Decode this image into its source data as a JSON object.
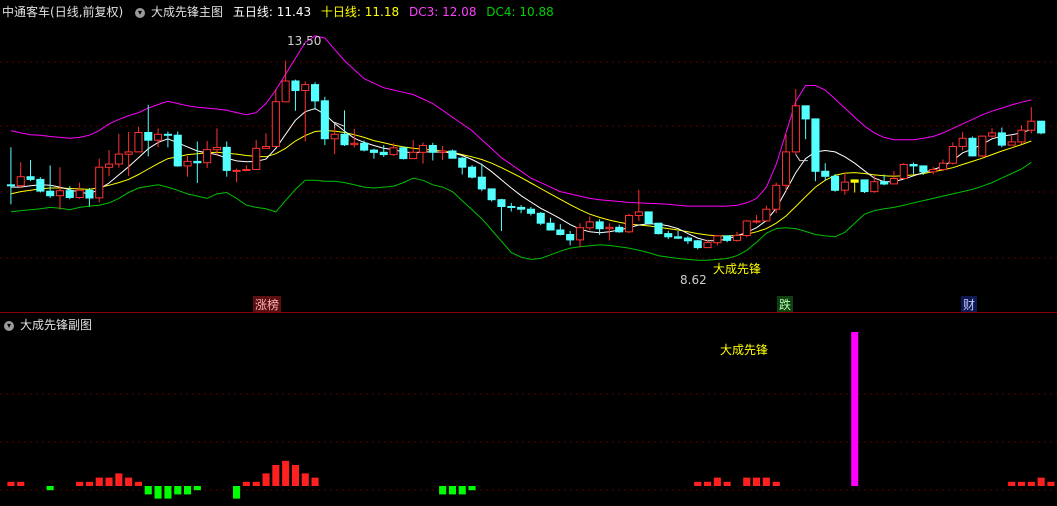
{
  "header": {
    "stock_name": "中通客车",
    "period": "(日线,前复权)",
    "indicator_name": "大成先锋主图",
    "ma5_label": "五日线: ",
    "ma5_value": "11.43",
    "ma10_label": "十日线: ",
    "ma10_value": "11.18",
    "dc3_label": "DC3: ",
    "dc3_value": "12.08",
    "dc4_label": "DC4: ",
    "dc4_value": "10.88"
  },
  "annotations": {
    "high_label": "13.50",
    "low_label": "8.62",
    "signal_label": "大成先锋"
  },
  "events": [
    {
      "label": "涨榜",
      "color": "#d04040"
    },
    {
      "label": "跌",
      "color": "#30a030"
    },
    {
      "label": "财",
      "color": "#3050c0"
    }
  ],
  "sub_panel": {
    "title": "大成先锋副图",
    "signal_label": "大成先锋"
  },
  "colors": {
    "up": "#ff3232",
    "down": "#54ffff",
    "ma5": "#ffffff",
    "ma10": "#ffff00",
    "dc3": "#ff00ff",
    "dc4": "#00c000",
    "signal_bar": "#ff00ff",
    "signal_candle": "#ffff00",
    "sub_up": "#ff2020",
    "sub_down": "#00ff00"
  },
  "chart_data": {
    "type": "candlestick",
    "candles": [
      [
        10.75,
        10.73,
        11.58,
        10.32
      ],
      [
        10.73,
        10.93,
        11.25,
        10.68
      ],
      [
        10.93,
        10.87,
        11.3,
        10.83
      ],
      [
        10.87,
        10.61,
        10.92,
        10.58
      ],
      [
        10.61,
        10.51,
        11.18,
        10.46
      ],
      [
        10.51,
        10.62,
        11.14,
        10.2
      ],
      [
        10.62,
        10.47,
        10.72,
        10.43
      ],
      [
        10.47,
        10.63,
        10.8,
        10.44
      ],
      [
        10.63,
        10.46,
        10.68,
        10.27
      ],
      [
        10.46,
        11.14,
        11.33,
        10.36
      ],
      [
        11.14,
        11.21,
        11.52,
        10.94
      ],
      [
        11.21,
        11.43,
        11.88,
        11.13
      ],
      [
        11.43,
        11.48,
        11.92,
        10.95
      ],
      [
        11.48,
        11.91,
        12.03,
        11.48
      ],
      [
        11.91,
        11.74,
        12.52,
        11.38
      ],
      [
        11.74,
        11.87,
        12.0,
        11.58
      ],
      [
        11.87,
        11.85,
        11.93,
        11.58
      ],
      [
        11.85,
        11.17,
        11.93,
        11.15
      ],
      [
        11.17,
        11.27,
        11.39,
        10.93
      ],
      [
        11.27,
        11.24,
        11.71,
        10.79
      ],
      [
        11.24,
        11.53,
        11.72,
        11.12
      ],
      [
        11.53,
        11.58,
        12.0,
        11.39
      ],
      [
        11.58,
        11.07,
        11.71,
        10.93
      ],
      [
        11.07,
        11.07,
        11.11,
        10.81
      ],
      [
        11.07,
        11.09,
        11.18,
        11.05
      ],
      [
        11.09,
        11.56,
        11.74,
        11.48
      ],
      [
        11.56,
        11.6,
        11.89,
        11.56
      ],
      [
        11.6,
        12.59,
        12.87,
        11.85
      ],
      [
        12.59,
        13.05,
        13.5,
        12.84
      ],
      [
        13.05,
        12.84,
        13.08,
        12.39
      ],
      [
        12.84,
        12.97,
        13.04,
        11.71
      ],
      [
        12.97,
        12.61,
        13.02,
        12.41
      ],
      [
        12.61,
        11.77,
        12.7,
        11.63
      ],
      [
        11.77,
        11.87,
        12.0,
        11.43
      ],
      [
        11.87,
        11.64,
        12.4,
        11.61
      ],
      [
        11.64,
        11.67,
        11.99,
        11.58
      ],
      [
        11.67,
        11.52,
        11.73,
        11.49
      ],
      [
        11.52,
        11.47,
        11.55,
        11.33
      ],
      [
        11.47,
        11.42,
        11.63,
        11.37
      ],
      [
        11.42,
        11.57,
        11.67,
        11.39
      ],
      [
        11.57,
        11.33,
        11.6,
        11.31
      ],
      [
        11.33,
        11.47,
        11.74,
        11.32
      ],
      [
        11.47,
        11.62,
        11.69,
        11.22
      ],
      [
        11.62,
        11.47,
        11.68,
        11.29
      ],
      [
        11.47,
        11.5,
        11.61,
        11.3
      ],
      [
        11.5,
        11.34,
        11.53,
        11.33
      ],
      [
        11.34,
        11.14,
        11.37,
        10.98
      ],
      [
        11.14,
        10.92,
        11.19,
        10.89
      ],
      [
        10.92,
        10.66,
        11.22,
        10.61
      ],
      [
        10.66,
        10.42,
        10.67,
        10.38
      ],
      [
        10.42,
        10.27,
        10.44,
        9.73
      ],
      [
        10.27,
        10.25,
        10.35,
        10.16
      ],
      [
        10.25,
        10.21,
        10.3,
        10.12
      ],
      [
        10.21,
        10.12,
        10.26,
        10.07
      ],
      [
        10.12,
        9.9,
        10.15,
        9.86
      ],
      [
        9.9,
        9.75,
        10.02,
        9.74
      ],
      [
        9.75,
        9.65,
        9.88,
        9.63
      ],
      [
        9.65,
        9.53,
        9.73,
        9.41
      ],
      [
        9.53,
        9.8,
        9.9,
        9.37
      ],
      [
        9.8,
        9.93,
        10.05,
        9.74
      ],
      [
        9.93,
        9.78,
        9.99,
        9.64
      ],
      [
        9.78,
        9.81,
        9.9,
        9.52
      ],
      [
        9.81,
        9.71,
        9.87,
        9.69
      ],
      [
        9.71,
        10.07,
        10.11,
        9.68
      ],
      [
        10.07,
        10.15,
        10.64,
        9.95
      ],
      [
        10.15,
        9.9,
        9.96,
        9.87
      ],
      [
        9.9,
        9.67,
        9.86,
        9.65
      ],
      [
        9.67,
        9.6,
        9.73,
        9.55
      ],
      [
        9.6,
        9.57,
        9.73,
        9.55
      ],
      [
        9.57,
        9.51,
        9.61,
        9.44
      ],
      [
        9.51,
        9.36,
        9.53,
        9.32
      ],
      [
        9.36,
        9.47,
        9.54,
        9.39
      ],
      [
        9.47,
        9.62,
        9.64,
        9.41
      ],
      [
        9.62,
        9.52,
        9.63,
        9.48
      ],
      [
        9.52,
        9.63,
        9.71,
        9.49
      ],
      [
        9.63,
        9.95,
        9.97,
        9.59
      ],
      [
        9.95,
        9.95,
        10.08,
        9.89
      ],
      [
        9.95,
        10.21,
        10.29,
        9.93
      ],
      [
        10.21,
        10.74,
        10.8,
        10.12
      ],
      [
        10.74,
        11.48,
        11.87,
        10.62
      ],
      [
        11.48,
        12.5,
        12.87,
        11.42
      ],
      [
        12.5,
        12.21,
        12.24,
        11.76
      ],
      [
        12.21,
        11.05,
        11.79,
        10.83
      ],
      [
        11.05,
        10.94,
        11.23,
        10.84
      ],
      [
        10.94,
        10.63,
        10.99,
        10.6
      ],
      [
        10.63,
        10.81,
        11.02,
        10.53
      ],
      [
        10.81,
        10.86,
        10.87,
        10.58
      ],
      [
        10.86,
        10.6,
        10.75,
        10.57
      ],
      [
        10.6,
        10.82,
        10.96,
        10.57
      ],
      [
        10.82,
        10.77,
        10.98,
        10.74
      ],
      [
        10.77,
        10.89,
        11.06,
        10.78
      ],
      [
        10.89,
        11.2,
        11.23,
        10.9
      ],
      [
        11.2,
        11.17,
        11.24,
        10.99
      ],
      [
        11.17,
        11.04,
        11.12,
        10.97
      ],
      [
        11.04,
        11.09,
        11.15,
        10.98
      ],
      [
        11.09,
        11.23,
        11.31,
        11.06
      ],
      [
        11.23,
        11.6,
        11.69,
        11.2
      ],
      [
        11.6,
        11.78,
        11.92,
        11.51
      ],
      [
        11.78,
        11.39,
        11.82,
        11.42
      ],
      [
        11.39,
        11.83,
        11.83,
        11.37
      ],
      [
        11.83,
        11.9,
        12.0,
        11.8
      ],
      [
        11.9,
        11.63,
        12.02,
        11.58
      ],
      [
        11.63,
        11.7,
        11.84,
        11.62
      ],
      [
        11.7,
        11.96,
        12.07,
        11.65
      ],
      [
        11.96,
        12.16,
        12.47,
        11.89
      ],
      [
        12.16,
        11.9,
        12.14,
        11.87
      ]
    ],
    "ma5": [
      10.7,
      10.7,
      10.73,
      10.75,
      10.74,
      10.7,
      10.64,
      10.59,
      10.55,
      10.65,
      10.79,
      10.97,
      11.15,
      11.35,
      11.55,
      11.69,
      11.77,
      11.68,
      11.59,
      11.5,
      11.46,
      11.42,
      11.34,
      11.28,
      11.26,
      11.27,
      11.32,
      11.56,
      11.87,
      12.18,
      12.37,
      12.44,
      12.31,
      12.11,
      11.94,
      11.78,
      11.69,
      11.62,
      11.56,
      11.53,
      11.48,
      11.46,
      11.48,
      11.48,
      11.47,
      11.46,
      11.4,
      11.31,
      11.2,
      11.04,
      10.86,
      10.68,
      10.51,
      10.37,
      10.23,
      10.12,
      10.0,
      9.87,
      9.77,
      9.71,
      9.69,
      9.71,
      9.75,
      9.8,
      9.86,
      9.89,
      9.88,
      9.84,
      9.78,
      9.67,
      9.57,
      9.51,
      9.51,
      9.55,
      9.62,
      9.7,
      9.8,
      9.96,
      10.23,
      10.62,
      11.02,
      11.33,
      11.48,
      11.51,
      11.48,
      11.37,
      11.23,
      11.06,
      10.9,
      10.82,
      10.82,
      10.88,
      10.95,
      11.02,
      11.09,
      11.16,
      11.29,
      11.46,
      11.54,
      11.65,
      11.77,
      11.83,
      11.86,
      11.9,
      11.98
    ],
    "ma10": [
      10.55,
      10.6,
      10.63,
      10.66,
      10.68,
      10.68,
      10.67,
      10.66,
      10.65,
      10.69,
      10.74,
      10.8,
      10.87,
      10.98,
      11.1,
      11.22,
      11.33,
      11.37,
      11.42,
      11.44,
      11.46,
      11.47,
      11.45,
      11.43,
      11.4,
      11.38,
      11.37,
      11.44,
      11.56,
      11.72,
      11.84,
      11.93,
      11.95,
      11.94,
      11.91,
      11.86,
      11.8,
      11.73,
      11.68,
      11.63,
      11.59,
      11.56,
      11.54,
      11.52,
      11.5,
      11.47,
      11.42,
      11.37,
      11.31,
      11.23,
      11.13,
      11.02,
      10.91,
      10.79,
      10.67,
      10.55,
      10.43,
      10.31,
      10.2,
      10.1,
      10.03,
      9.97,
      9.92,
      9.88,
      9.86,
      9.84,
      9.81,
      9.78,
      9.75,
      9.71,
      9.67,
      9.64,
      9.62,
      9.62,
      9.63,
      9.66,
      9.71,
      9.78,
      9.9,
      10.06,
      10.27,
      10.49,
      10.7,
      10.85,
      10.96,
      11.01,
      11.02,
      11.0,
      10.97,
      10.95,
      10.94,
      10.95,
      10.97,
      11.0,
      11.04,
      11.08,
      11.13,
      11.2,
      11.27,
      11.34,
      11.42,
      11.5,
      11.57,
      11.64,
      11.72
    ],
    "dc3": [
      11.95,
      11.9,
      11.86,
      11.85,
      11.82,
      11.8,
      11.78,
      11.8,
      11.85,
      11.95,
      12.1,
      12.2,
      12.28,
      12.35,
      12.45,
      12.53,
      12.6,
      12.55,
      12.5,
      12.47,
      12.45,
      12.43,
      12.4,
      12.35,
      12.3,
      12.35,
      12.55,
      12.85,
      13.2,
      13.55,
      13.9,
      14.05,
      14.0,
      13.75,
      13.5,
      13.3,
      13.1,
      13.0,
      12.9,
      12.85,
      12.8,
      12.75,
      12.65,
      12.55,
      12.4,
      12.25,
      12.1,
      11.95,
      11.75,
      11.55,
      11.35,
      11.2,
      11.05,
      10.9,
      10.8,
      10.7,
      10.6,
      10.55,
      10.5,
      10.45,
      10.42,
      10.4,
      10.38,
      10.36,
      10.35,
      10.34,
      10.33,
      10.32,
      10.3,
      10.28,
      10.28,
      10.28,
      10.28,
      10.28,
      10.3,
      10.35,
      10.45,
      10.7,
      11.2,
      11.9,
      12.6,
      12.95,
      12.95,
      12.85,
      12.65,
      12.45,
      12.25,
      12.05,
      11.9,
      11.8,
      11.75,
      11.75,
      11.75,
      11.78,
      11.82,
      11.9,
      12.0,
      12.1,
      12.2,
      12.3,
      12.38,
      12.45,
      12.52,
      12.58,
      12.63
    ],
    "dc4": [
      10.15,
      10.18,
      10.2,
      10.22,
      10.25,
      10.23,
      10.2,
      10.25,
      10.28,
      10.3,
      10.35,
      10.45,
      10.58,
      10.68,
      10.72,
      10.75,
      10.7,
      10.63,
      10.55,
      10.5,
      10.45,
      10.55,
      10.58,
      10.45,
      10.3,
      10.25,
      10.22,
      10.15,
      10.4,
      10.65,
      10.85,
      10.85,
      10.83,
      10.83,
      10.8,
      10.75,
      10.7,
      10.68,
      10.7,
      10.72,
      10.8,
      10.9,
      10.85,
      10.75,
      10.7,
      10.6,
      10.4,
      10.2,
      10.0,
      9.75,
      9.5,
      9.25,
      9.15,
      9.1,
      9.12,
      9.2,
      9.28,
      9.35,
      9.38,
      9.4,
      9.42,
      9.41,
      9.38,
      9.35,
      9.3,
      9.25,
      9.18,
      9.15,
      9.12,
      9.1,
      9.08,
      9.08,
      9.1,
      9.12,
      9.18,
      9.3,
      9.48,
      9.68,
      9.78,
      9.8,
      9.78,
      9.72,
      9.65,
      9.62,
      9.6,
      9.7,
      9.9,
      10.1,
      10.18,
      10.22,
      10.25,
      10.3,
      10.35,
      10.4,
      10.45,
      10.5,
      10.55,
      10.6,
      10.65,
      10.72,
      10.8,
      10.9,
      11.0,
      11.1,
      11.25
    ],
    "sub_values": [
      1,
      1,
      0,
      0,
      -1,
      0,
      0,
      1,
      1,
      2,
      2,
      3,
      2,
      1,
      -2,
      -3,
      -3,
      -2,
      -2,
      -1,
      0,
      0,
      0,
      -3,
      1,
      1,
      3,
      5,
      6,
      5,
      3,
      2,
      0,
      0,
      0,
      0,
      0,
      0,
      0,
      0,
      0,
      0,
      0,
      0,
      -2,
      -2,
      -2,
      -1,
      0,
      0,
      0,
      0,
      0,
      0,
      0,
      0,
      0,
      0,
      0,
      0,
      0,
      0,
      0,
      0,
      0,
      0,
      0,
      0,
      0,
      0,
      1,
      1,
      2,
      1,
      0,
      2,
      2,
      2,
      1,
      0,
      0,
      0,
      0,
      0,
      0,
      0,
      0,
      0,
      0,
      0,
      0,
      0,
      0,
      0,
      0,
      0,
      0,
      0,
      0,
      0,
      0,
      0,
      1,
      1,
      1,
      2,
      1,
      1,
      0,
      0
    ],
    "signal_index": 86,
    "event_indices": [
      31,
      94,
      118
    ],
    "high_index": 33,
    "low_index": 80,
    "y_range": [
      8.2,
      14.4
    ]
  }
}
